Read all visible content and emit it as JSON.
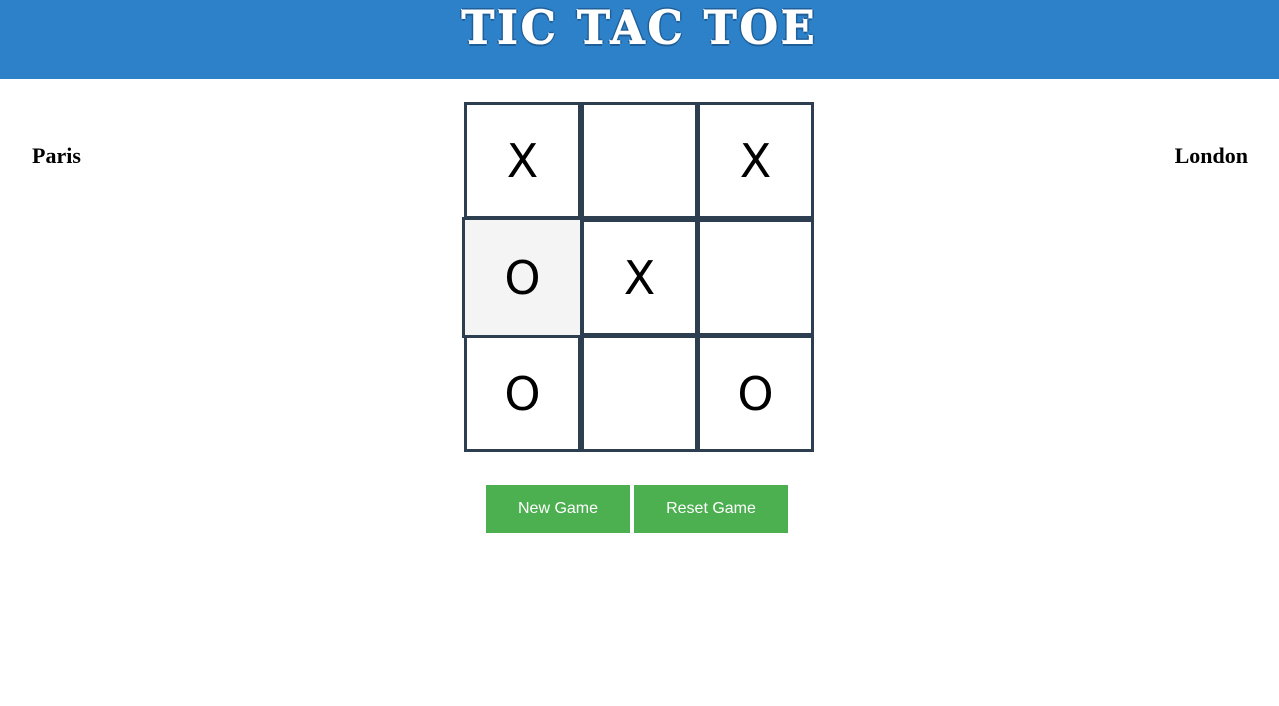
{
  "header": {
    "title": "TIC TAC TOE",
    "color": "#2d81c9"
  },
  "players": {
    "left": "Paris",
    "right": "London"
  },
  "board": {
    "cells": [
      "X",
      "",
      "X",
      "O",
      "X",
      "",
      "O",
      "",
      "O"
    ],
    "highlighted_cell": 3
  },
  "buttons": {
    "new_game": "New Game",
    "reset_game": "Reset Game",
    "color": "#4caf50"
  }
}
